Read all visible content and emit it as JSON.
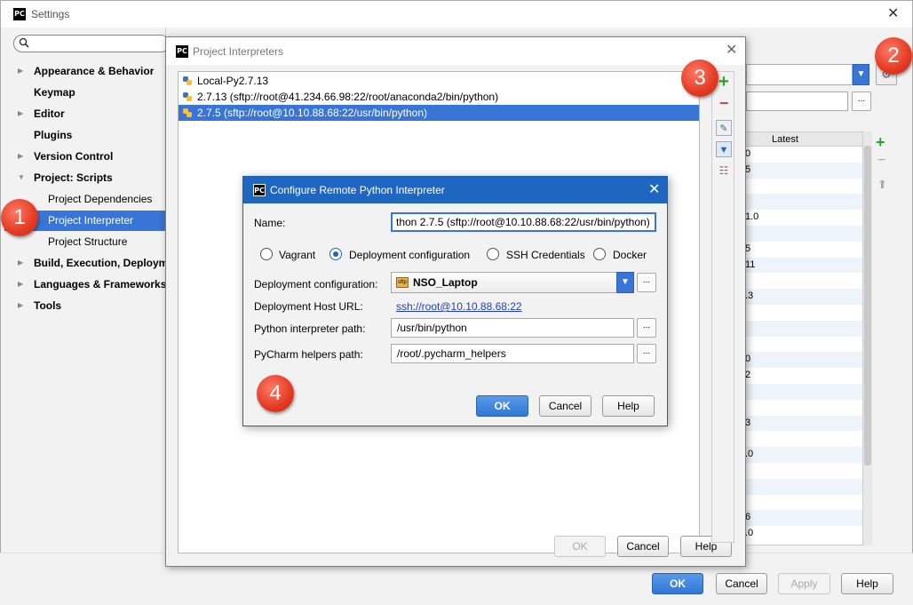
{
  "settings_window": {
    "title": "Settings",
    "search_placeholder": "",
    "nav_items": [
      {
        "label": "Appearance & Behavior",
        "bold": true,
        "arrow": "▶"
      },
      {
        "label": "Keymap",
        "bold": true,
        "arrow": ""
      },
      {
        "label": "Editor",
        "bold": true,
        "arrow": "▶"
      },
      {
        "label": "Plugins",
        "bold": true,
        "arrow": ""
      },
      {
        "label": "Version Control",
        "bold": true,
        "arrow": "▶"
      },
      {
        "label": "Project: Scripts",
        "bold": true,
        "arrow": "▼"
      },
      {
        "label": "Project Dependencies",
        "bold": false,
        "arrow": ""
      },
      {
        "label": "Project Interpreter",
        "bold": false,
        "arrow": "",
        "selected": true
      },
      {
        "label": "Project Structure",
        "bold": false,
        "arrow": ""
      },
      {
        "label": "Build, Execution, Deployment",
        "bold": true,
        "arrow": "▶"
      },
      {
        "label": "Languages & Frameworks",
        "bold": true,
        "arrow": "▶"
      },
      {
        "label": "Tools",
        "bold": true,
        "arrow": "▶"
      }
    ],
    "packages_header_latest": "Latest",
    "packages_latest_values": [
      "0",
      "5",
      "",
      "",
      "1.0",
      "",
      "5",
      "11",
      "",
      ".3",
      "",
      "",
      "",
      "0",
      "2",
      "",
      "",
      "3",
      "",
      ".0",
      "",
      "",
      "",
      "6",
      ".0"
    ],
    "buttons": {
      "ok": "OK",
      "cancel": "Cancel",
      "apply": "Apply",
      "help": "Help"
    }
  },
  "interpreters_dialog": {
    "title": "Project Interpreters",
    "interpreters": [
      "Local-Py2.7.13",
      "2.7.13 (sftp://root@41.234.66.98:22/root/anaconda2/bin/python)",
      "2.7.5 (sftp://root@10.10.88.68:22/usr/bin/python)"
    ],
    "buttons": {
      "ok": "OK",
      "cancel": "Cancel",
      "help": "Help"
    }
  },
  "configure_dialog": {
    "title": "Configure Remote Python Interpreter",
    "name_label": "Name:",
    "name_value": "thon 2.7.5 (sftp://root@10.10.88.68:22/usr/bin/python)",
    "radio_vagrant": "Vagrant",
    "radio_deployment": "Deployment configuration",
    "radio_ssh": "SSH Credentials",
    "radio_docker": "Docker",
    "deployment_config_label": "Deployment configuration:",
    "deployment_config_value": "NSO_Laptop",
    "sftp_icon_text": "sftp",
    "host_url_label": "Deployment Host URL:",
    "host_url_value": "ssh://root@10.10.88.68:22",
    "interpreter_path_label": "Python interpreter path:",
    "interpreter_path_value": "/usr/bin/python",
    "helpers_path_label": "PyCharm helpers path:",
    "helpers_path_value": "/root/.pycharm_helpers",
    "dots": "...",
    "buttons": {
      "ok": "OK",
      "cancel": "Cancel",
      "help": "Help"
    }
  },
  "annotations": [
    "1",
    "2",
    "3",
    "4"
  ],
  "app_logo_text": "PC",
  "colors": {
    "accent": "#3875d7",
    "title_blue": "#1e66c0",
    "badge_red": "#e33a22",
    "add_green": "#2aa52a",
    "remove_red": "#d9443a"
  }
}
